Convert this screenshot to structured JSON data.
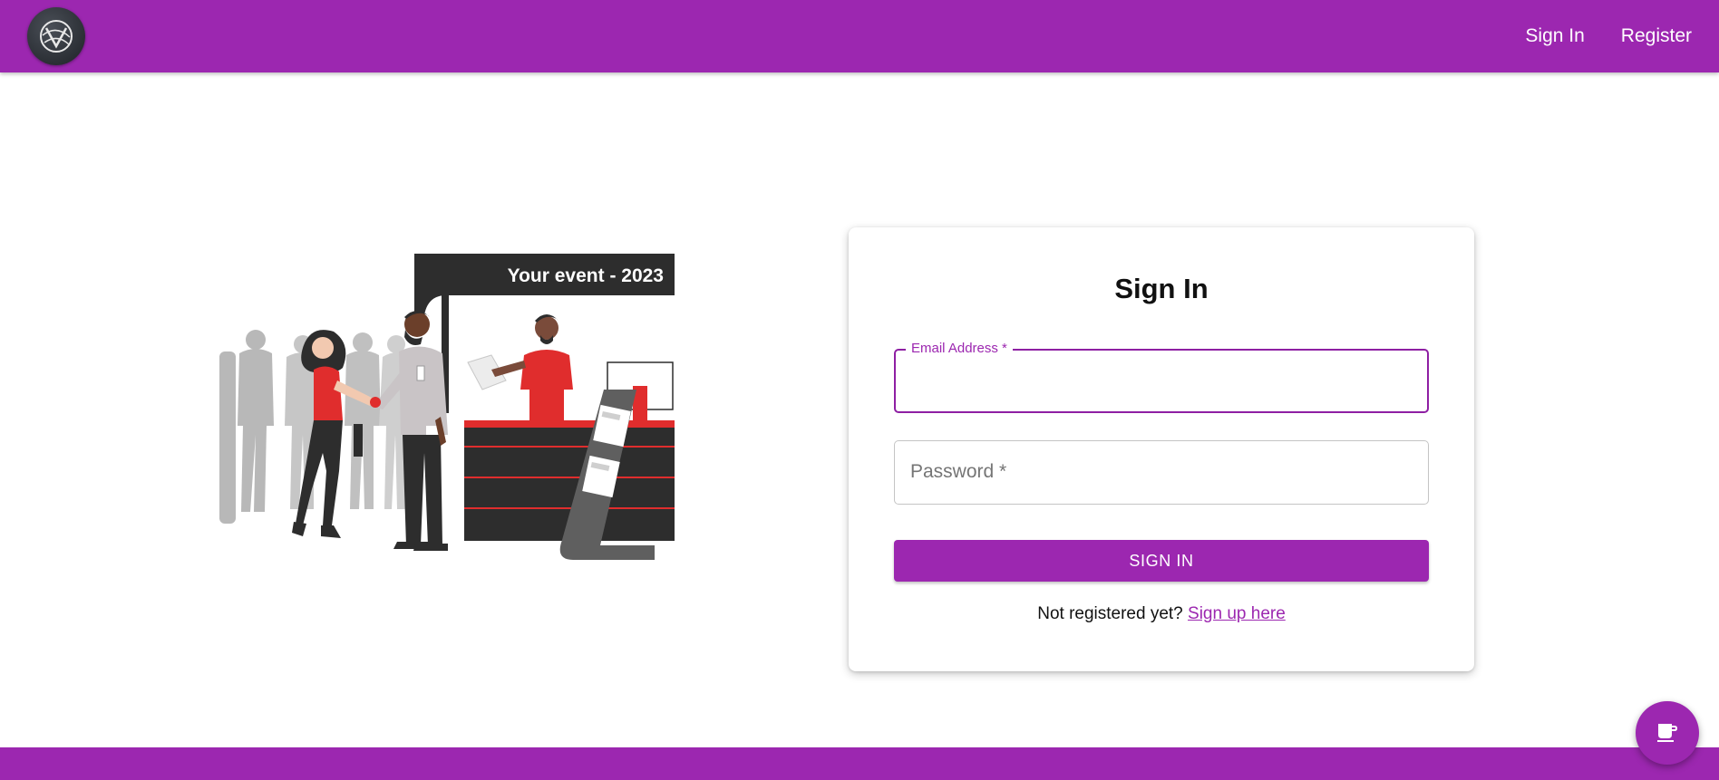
{
  "header": {
    "logo_icon": "globe-logo-icon",
    "nav": [
      {
        "label": "Sign In"
      },
      {
        "label": "Register"
      }
    ]
  },
  "illustration": {
    "banner_text": "Your event - 2023"
  },
  "form": {
    "title": "Sign In",
    "email_label": "Email Address *",
    "email_value": "",
    "password_label": "Password *",
    "password_value": "",
    "submit_label": "SIGN IN",
    "footer_prompt": "Not registered yet?",
    "footer_link": "Sign up here"
  },
  "fab": {
    "icon": "coffee-cup-icon"
  },
  "colors": {
    "primary": "#9c27b0",
    "primary_dark": "#8e1fa3",
    "illustration_red": "#e02d2d",
    "illustration_dark": "#2d2d2d"
  }
}
